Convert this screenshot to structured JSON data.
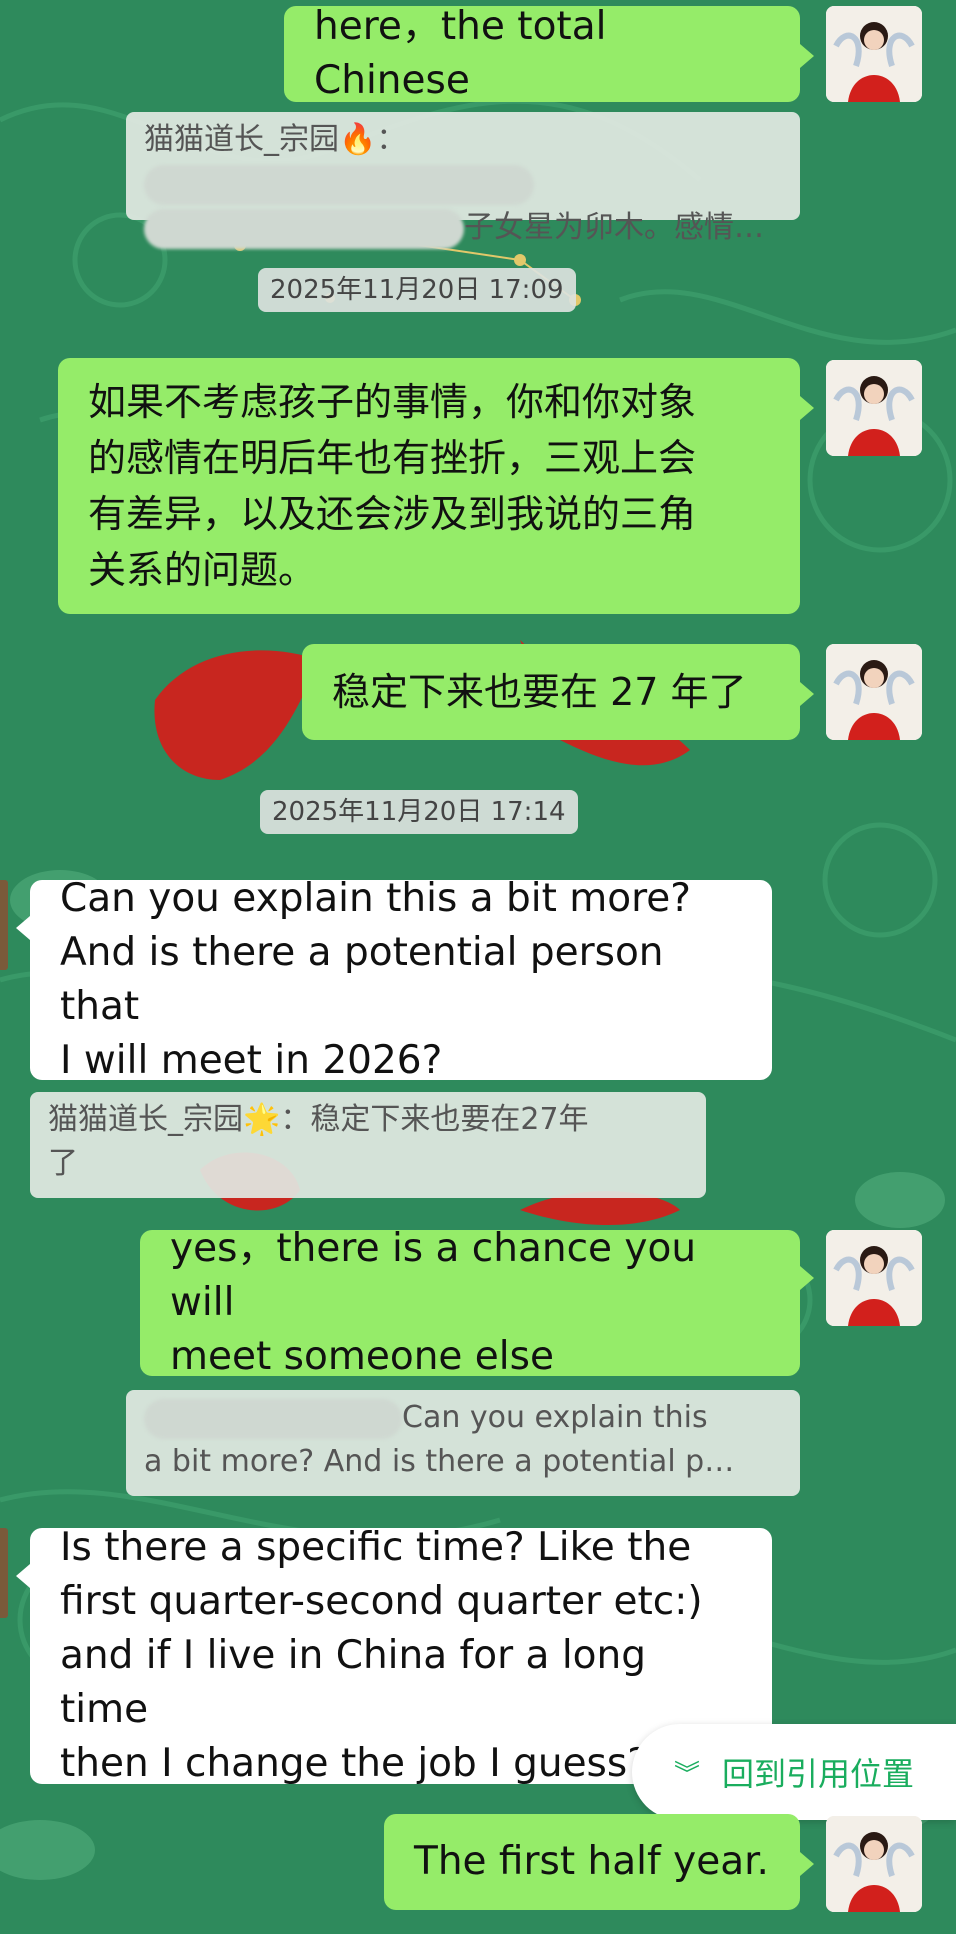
{
  "colors": {
    "background": "#2e8a5c",
    "outgoing_bubble": "#95ec69",
    "incoming_bubble": "#ffffff",
    "accent": "#1aad5e"
  },
  "messages": {
    "m1": "here，the total Chinese",
    "m2_lines": [
      "如果不考虑孩子的事情，你和你对象",
      "的感情在明后年也有挫折，三观上会",
      "有差异，以及还会涉及到我说的三角",
      "关系的问题。"
    ],
    "m3": "稳定下来也要在 27 年了",
    "m4_lines": [
      "Can you explain this a bit more?",
      "And is there a potential person that",
      "I will meet in 2026?"
    ],
    "m5_lines": [
      "yes，there is a chance you will",
      "meet someone else"
    ],
    "m6_lines": [
      "Is there a specific time? Like the",
      "first quarter-second quarter etc:)",
      "and if I live in China for a long time",
      "then I change the job I guess?"
    ],
    "m7": "The first half year."
  },
  "quotes": {
    "q1_author": "猫猫道长_宗园",
    "q1_icon": "fire-icon",
    "q1_line2_tail": "子女星为卯木。感情…",
    "q2_line1": "猫猫道长_宗园",
    "q2_icon": "star-icon",
    "q2_line1_tail": "：稳定下来也要在27年",
    "q2_line2": "了",
    "q3_line1_tail": "Can you explain this",
    "q3_line2": "a bit more? And is there a potential p…"
  },
  "timestamps": {
    "t1": "2025年11月20日 17:09",
    "t2": "2025年11月20日 17:14"
  },
  "back_to_quote": {
    "label": "回到引用位置",
    "icon": "double-chevron-down-icon"
  }
}
